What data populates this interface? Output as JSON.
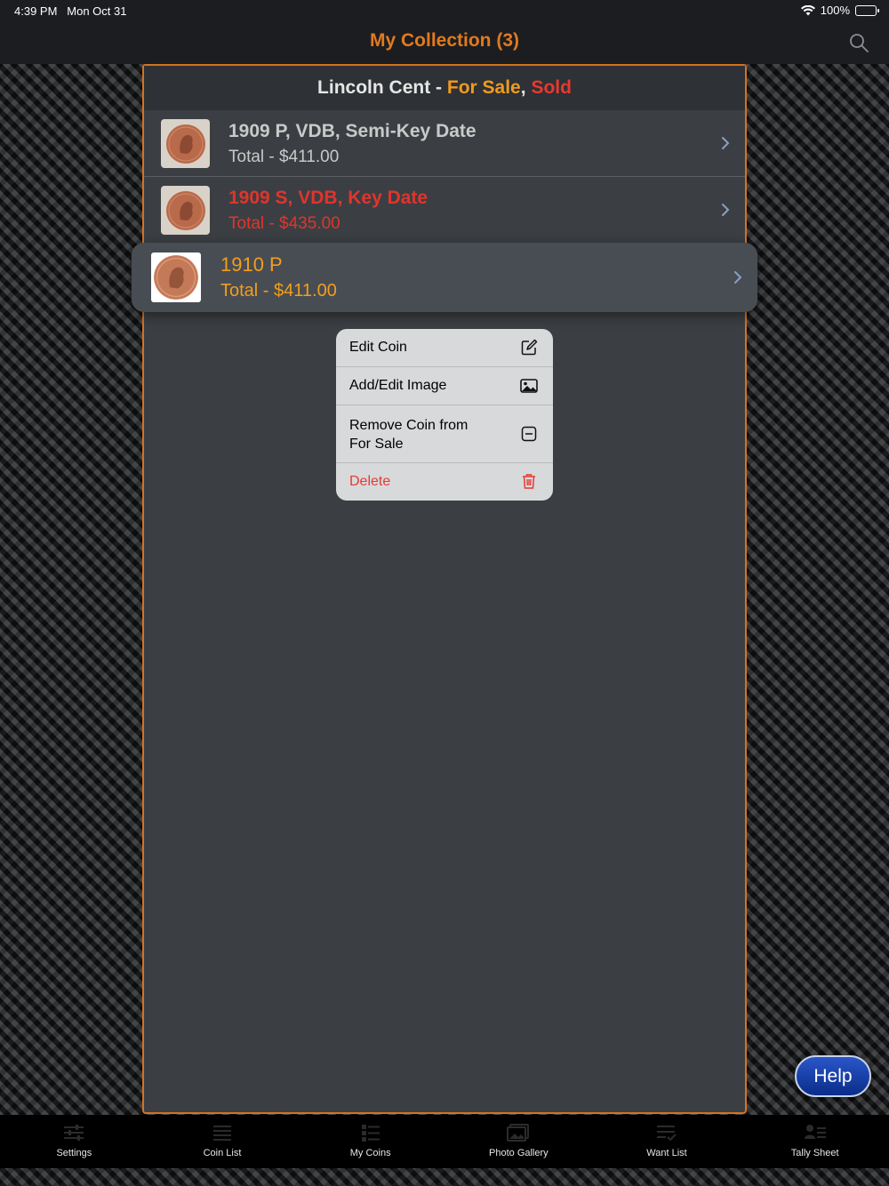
{
  "status_bar": {
    "time": "4:39 PM",
    "date": "Mon Oct 31",
    "battery": "100%",
    "battery_level": 1.0,
    "wifi_icon": "wifi-icon"
  },
  "nav": {
    "title": "My Collection (3)",
    "search_icon": "search-icon"
  },
  "colors": {
    "accent": "#e07a1f",
    "for_sale": "#f19a1e",
    "sold": "#e8392f",
    "panel_bg": "#3b3f43",
    "help": "#1b43b0"
  },
  "panel": {
    "header": {
      "prefix": "Lincoln Cent - ",
      "for_sale": "For Sale",
      "comma": ",",
      "sold": "Sold"
    },
    "rows": [
      {
        "title": "1909 P, VDB, Semi-Key Date",
        "total": "Total - $411.00",
        "status": "normal"
      },
      {
        "title": "1909 S, VDB, Key Date",
        "total": "Total - $435.00",
        "status": "sold"
      }
    ],
    "selected_row": {
      "title": "1910 P",
      "total": "Total - $411.00",
      "status": "for-sale"
    }
  },
  "context_menu": {
    "items": [
      {
        "label": "Edit Coin",
        "icon": "edit-icon"
      },
      {
        "label": "Add/Edit Image",
        "icon": "image-icon"
      },
      {
        "label": "Remove Coin from For Sale",
        "icon": "minus-square-icon"
      },
      {
        "label": "Delete",
        "icon": "trash-icon",
        "destructive": true
      }
    ]
  },
  "help_button": {
    "label": "Help"
  },
  "tab_bar": {
    "tabs": [
      {
        "label": "Settings",
        "icon": "sliders-icon"
      },
      {
        "label": "Coin List",
        "icon": "list-icon"
      },
      {
        "label": "My Coins",
        "icon": "my-coins-icon"
      },
      {
        "label": "Photo Gallery",
        "icon": "photo-gallery-icon"
      },
      {
        "label": "Want List",
        "icon": "want-list-icon"
      },
      {
        "label": "Tally Sheet",
        "icon": "tally-sheet-icon"
      }
    ]
  }
}
